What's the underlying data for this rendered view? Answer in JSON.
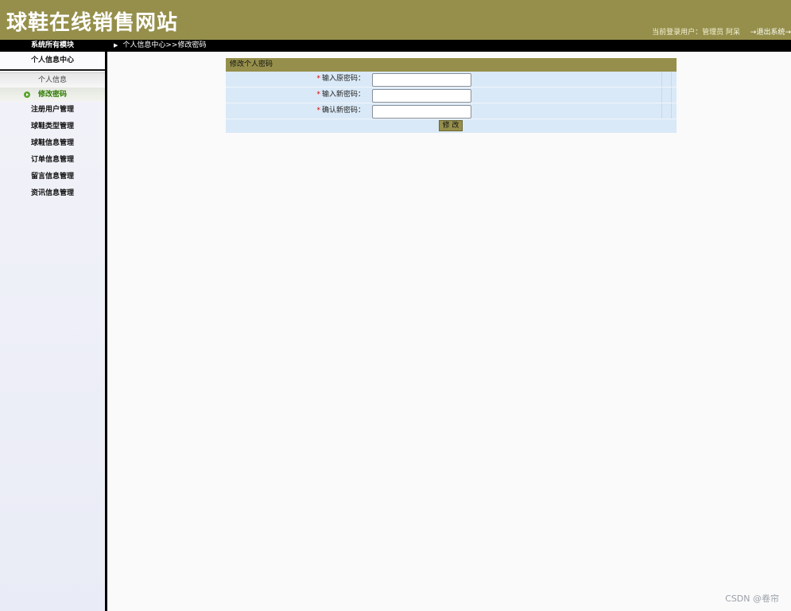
{
  "header": {
    "site_title": "球鞋在线销售网站",
    "user_info": "当前登录用户：管理员 阿呆",
    "logout_label": "→退出系统→"
  },
  "topbar": {
    "module_title": "系统所有模块",
    "breadcrumb": "个人信息中心>>修改密码"
  },
  "sidebar": {
    "head": "个人信息中心",
    "sub_label": "个人信息",
    "active_item": "修改密码",
    "items": [
      {
        "label": "注册用户管理"
      },
      {
        "label": "球鞋类型管理"
      },
      {
        "label": "球鞋信息管理"
      },
      {
        "label": "订单信息管理"
      },
      {
        "label": "留言信息管理"
      },
      {
        "label": "资讯信息管理"
      }
    ]
  },
  "form": {
    "title": "修改个人密码",
    "required_mark": "*",
    "fields": [
      {
        "label": "输入原密码：",
        "value": ""
      },
      {
        "label": "输入新密码：",
        "value": ""
      },
      {
        "label": "确认新密码：",
        "value": ""
      }
    ],
    "submit_label": "修 改"
  },
  "watermark": "CSDN @卷帘",
  "colors": {
    "header_bg": "#958f4b",
    "form_row_bg": "#dae9f7",
    "active_text": "#2d7a00"
  },
  "icons": {
    "breadcrumb_arrow": "triangle-right-icon",
    "active_bullet": "green-arrow-bullet-icon"
  }
}
